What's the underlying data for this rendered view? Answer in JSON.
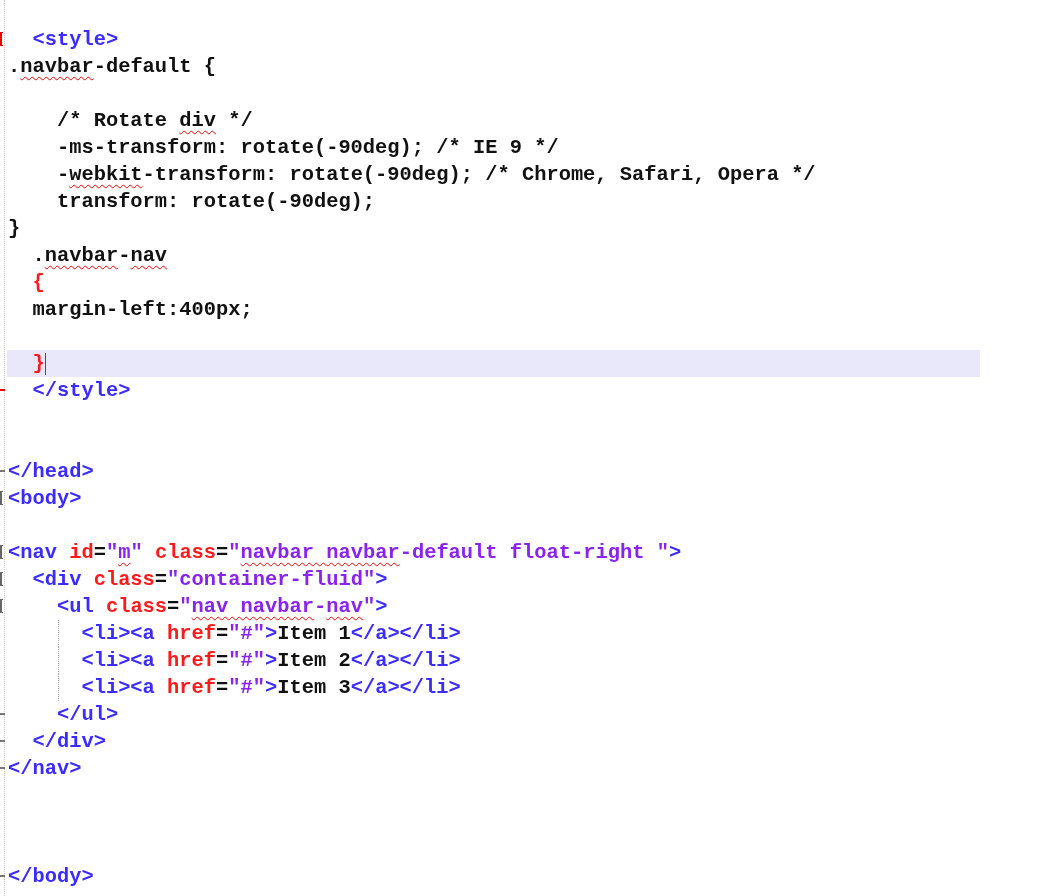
{
  "lines": [
    {
      "kind": "code",
      "fold": {
        "kind": "start",
        "color": "#ee0000"
      },
      "tokens": [
        {
          "kind": "tag",
          "text": "  <style>"
        }
      ]
    },
    {
      "kind": "code",
      "tokens": [
        {
          "kind": "text",
          "text": "."
        },
        {
          "kind": "text",
          "text": "navbar",
          "squiggle": true
        },
        {
          "kind": "text",
          "text": "-default {"
        }
      ]
    },
    {
      "kind": "blank"
    },
    {
      "kind": "code",
      "tokens": [
        {
          "kind": "text",
          "text": "    /* Rotate "
        },
        {
          "kind": "text",
          "text": "div",
          "squiggle": true
        },
        {
          "kind": "text",
          "text": " */"
        }
      ]
    },
    {
      "kind": "code",
      "tokens": [
        {
          "kind": "text",
          "text": "    -ms-transform: rotate(-90deg); /* IE 9 */"
        }
      ]
    },
    {
      "kind": "code",
      "tokens": [
        {
          "kind": "text",
          "text": "    -"
        },
        {
          "kind": "text",
          "text": "webkit",
          "squiggle": true
        },
        {
          "kind": "text",
          "text": "-transform: rotate(-90deg); /* Chrome, Safari, Opera */"
        }
      ]
    },
    {
      "kind": "code",
      "tokens": [
        {
          "kind": "text",
          "text": "    transform: rotate(-90deg);"
        }
      ]
    },
    {
      "kind": "code",
      "tokens": [
        {
          "kind": "text",
          "text": "}"
        }
      ]
    },
    {
      "kind": "code",
      "tokens": [
        {
          "kind": "text",
          "text": "  ."
        },
        {
          "kind": "text",
          "text": "navbar",
          "squiggle": true
        },
        {
          "kind": "text",
          "text": "-"
        },
        {
          "kind": "text",
          "text": "nav",
          "squiggle": true
        }
      ]
    },
    {
      "kind": "code",
      "tokens": [
        {
          "kind": "brace",
          "text": "  {"
        }
      ]
    },
    {
      "kind": "code",
      "tokens": [
        {
          "kind": "text",
          "text": "  margin-left:400px;"
        }
      ]
    },
    {
      "kind": "blank"
    },
    {
      "kind": "code",
      "current": true,
      "tokens": [
        {
          "kind": "brace",
          "text": "  }"
        }
      ]
    },
    {
      "kind": "code",
      "fold": {
        "kind": "end",
        "color": "#ee0000"
      },
      "tokens": [
        {
          "kind": "tag",
          "text": "  </style>"
        }
      ]
    },
    {
      "kind": "blank"
    },
    {
      "kind": "blank"
    },
    {
      "kind": "code",
      "fold": {
        "kind": "end",
        "color": "#777777"
      },
      "tokens": [
        {
          "kind": "tag",
          "text": "</head>"
        }
      ]
    },
    {
      "kind": "code",
      "fold": {
        "kind": "start",
        "color": "#666666"
      },
      "tokens": [
        {
          "kind": "tag",
          "text": "<body>"
        }
      ]
    },
    {
      "kind": "blank"
    },
    {
      "kind": "code",
      "fold": {
        "kind": "start",
        "color": "#666666"
      },
      "tokens": [
        {
          "kind": "tag",
          "text": "<nav "
        },
        {
          "kind": "attr",
          "text": "id"
        },
        {
          "kind": "text",
          "text": "="
        },
        {
          "kind": "value",
          "text": "\""
        },
        {
          "kind": "value",
          "text": "m",
          "squiggle": true
        },
        {
          "kind": "value",
          "text": "\" "
        },
        {
          "kind": "attr",
          "text": "class"
        },
        {
          "kind": "text",
          "text": "="
        },
        {
          "kind": "value",
          "text": "\""
        },
        {
          "kind": "value",
          "text": "navbar ",
          "squiggle": true
        },
        {
          "kind": "value",
          "text": "navbar",
          "squiggle": true
        },
        {
          "kind": "value",
          "text": "-default float-right \""
        },
        {
          "kind": "tag",
          "text": ">"
        }
      ]
    },
    {
      "kind": "code",
      "fold": {
        "kind": "start",
        "color": "#666666"
      },
      "tokens": [
        {
          "kind": "tag",
          "text": "  <div "
        },
        {
          "kind": "attr",
          "text": "class"
        },
        {
          "kind": "text",
          "text": "="
        },
        {
          "kind": "value",
          "text": "\"container-fluid\""
        },
        {
          "kind": "tag",
          "text": ">"
        }
      ]
    },
    {
      "kind": "code",
      "fold": {
        "kind": "start",
        "color": "#666666"
      },
      "tokens": [
        {
          "kind": "tag",
          "text": "    <ul "
        },
        {
          "kind": "attr",
          "text": "class"
        },
        {
          "kind": "text",
          "text": "="
        },
        {
          "kind": "value",
          "text": "\""
        },
        {
          "kind": "value",
          "text": "nav ",
          "squiggle": true
        },
        {
          "kind": "value",
          "text": "navbar",
          "squiggle": true
        },
        {
          "kind": "value",
          "text": "-"
        },
        {
          "kind": "value",
          "text": "nav",
          "squiggle": true
        },
        {
          "kind": "value",
          "text": "\""
        },
        {
          "kind": "tag",
          "text": ">"
        }
      ]
    },
    {
      "kind": "code",
      "guide": true,
      "tokens": [
        {
          "kind": "tag",
          "text": "      <li><a "
        },
        {
          "kind": "attr",
          "text": "href"
        },
        {
          "kind": "text",
          "text": "="
        },
        {
          "kind": "value",
          "text": "\"#\""
        },
        {
          "kind": "tag",
          "text": ">"
        },
        {
          "kind": "text",
          "text": "Item 1"
        },
        {
          "kind": "tag",
          "text": "</a></li>"
        }
      ]
    },
    {
      "kind": "code",
      "guide": true,
      "tokens": [
        {
          "kind": "tag",
          "text": "      <li><a "
        },
        {
          "kind": "attr",
          "text": "href"
        },
        {
          "kind": "text",
          "text": "="
        },
        {
          "kind": "value",
          "text": "\"#\""
        },
        {
          "kind": "tag",
          "text": ">"
        },
        {
          "kind": "text",
          "text": "Item 2"
        },
        {
          "kind": "tag",
          "text": "</a></li>"
        }
      ]
    },
    {
      "kind": "code",
      "guide": true,
      "tokens": [
        {
          "kind": "tag",
          "text": "      <li><a "
        },
        {
          "kind": "attr",
          "text": "href"
        },
        {
          "kind": "text",
          "text": "="
        },
        {
          "kind": "value",
          "text": "\"#\""
        },
        {
          "kind": "tag",
          "text": ">"
        },
        {
          "kind": "text",
          "text": "Item 3"
        },
        {
          "kind": "tag",
          "text": "</a></li>"
        }
      ]
    },
    {
      "kind": "code",
      "fold": {
        "kind": "end",
        "color": "#777777"
      },
      "tokens": [
        {
          "kind": "tag",
          "text": "    </ul>"
        }
      ]
    },
    {
      "kind": "code",
      "fold": {
        "kind": "end",
        "color": "#777777"
      },
      "tokens": [
        {
          "kind": "tag",
          "text": "  </div>"
        }
      ]
    },
    {
      "kind": "code",
      "fold": {
        "kind": "end",
        "color": "#777777"
      },
      "tokens": [
        {
          "kind": "tag",
          "text": "</nav>"
        }
      ]
    },
    {
      "kind": "blank"
    },
    {
      "kind": "blank"
    },
    {
      "kind": "blank"
    },
    {
      "kind": "code",
      "fold": {
        "kind": "end",
        "color": "#777777"
      },
      "tokens": [
        {
          "kind": "tag",
          "text": "</body>"
        }
      ]
    }
  ]
}
